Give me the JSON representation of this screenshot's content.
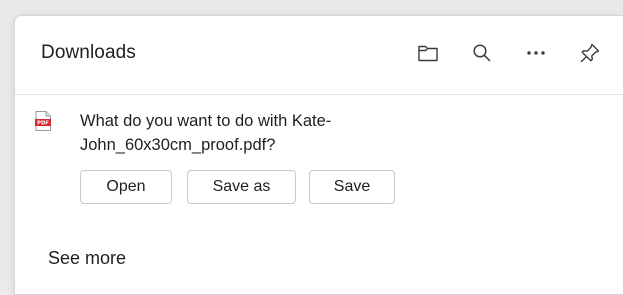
{
  "panel": {
    "title": "Downloads",
    "icons": {
      "folder": "folder-icon",
      "search": "search-icon",
      "more": "more-options-icon",
      "pin": "pin-icon"
    }
  },
  "download_item": {
    "file_icon": "pdf-file-icon",
    "file_icon_label": "PDF",
    "message": "What do you want to do with Kate-John_60x30cm_proof.pdf?",
    "buttons": {
      "open": "Open",
      "save_as": "Save as",
      "save": "Save"
    }
  },
  "footer": {
    "see_more": "See more"
  },
  "colors": {
    "pdf_red": "#d9272e",
    "text": "#1f1f1f",
    "border": "#c8c8c8"
  }
}
